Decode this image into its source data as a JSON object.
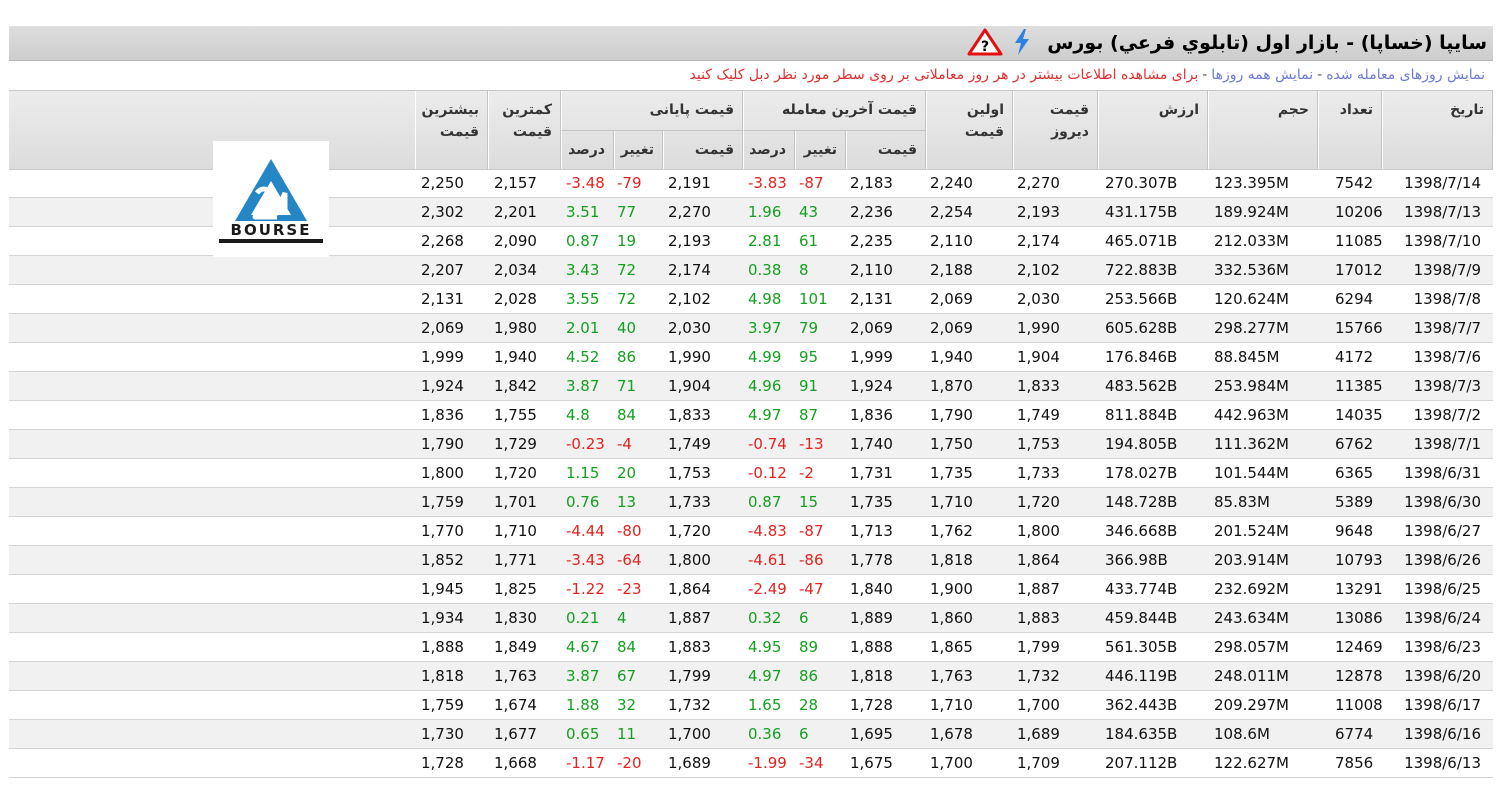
{
  "title": "سایپا (خساپا) - بازار اول (تابلوي فرعي) بورس",
  "icons": {
    "bolt": "lightning-bolt-icon",
    "warning": "warning-triangle-question-icon"
  },
  "colors": {
    "positive": "#13a01e",
    "negative": "#e4231f",
    "link": "#6d7bd8",
    "hint": "#e03030"
  },
  "info": {
    "link_traded": "نمایش روزهای معامله شده",
    "separator": "-",
    "link_all": "نمایش همه روزها",
    "hint": "برای مشاهده اطلاعات بیشتر در هر روز معاملاتی بر روی سطر مورد نظر دبل کلیک کنید"
  },
  "headers": {
    "date": "تاریخ",
    "count": "تعداد",
    "volume": "حجم",
    "value": "ارزش",
    "yesterday": "قیمت دیروز",
    "first": "اولین قیمت",
    "last_group": "قیمت آخرین معامله",
    "close_group": "قیمت پایانی",
    "price": "قیمت",
    "change": "تغییر",
    "percent": "درصد",
    "min": "کمترین قیمت",
    "max": "بیشترین قیمت"
  },
  "rows": [
    {
      "date": "1398/7/14",
      "count": "7542",
      "volume": "123.395M",
      "value": "270.307B",
      "yesterday": "2,270",
      "first": "2,240",
      "last_price": "2,183",
      "last_change": "-87",
      "last_pct": "-3.83",
      "close_price": "2,191",
      "close_change": "-79",
      "close_pct": "-3.48",
      "min": "2,157",
      "max": "2,250"
    },
    {
      "date": "1398/7/13",
      "count": "10206",
      "volume": "189.924M",
      "value": "431.175B",
      "yesterday": "2,193",
      "first": "2,254",
      "last_price": "2,236",
      "last_change": "43",
      "last_pct": "1.96",
      "close_price": "2,270",
      "close_change": "77",
      "close_pct": "3.51",
      "min": "2,201",
      "max": "2,302"
    },
    {
      "date": "1398/7/10",
      "count": "11085",
      "volume": "212.033M",
      "value": "465.071B",
      "yesterday": "2,174",
      "first": "2,110",
      "last_price": "2,235",
      "last_change": "61",
      "last_pct": "2.81",
      "close_price": "2,193",
      "close_change": "19",
      "close_pct": "0.87",
      "min": "2,090",
      "max": "2,268"
    },
    {
      "date": "1398/7/9",
      "count": "17012",
      "volume": "332.536M",
      "value": "722.883B",
      "yesterday": "2,102",
      "first": "2,188",
      "last_price": "2,110",
      "last_change": "8",
      "last_pct": "0.38",
      "close_price": "2,174",
      "close_change": "72",
      "close_pct": "3.43",
      "min": "2,034",
      "max": "2,207"
    },
    {
      "date": "1398/7/8",
      "count": "6294",
      "volume": "120.624M",
      "value": "253.566B",
      "yesterday": "2,030",
      "first": "2,069",
      "last_price": "2,131",
      "last_change": "101",
      "last_pct": "4.98",
      "close_price": "2,102",
      "close_change": "72",
      "close_pct": "3.55",
      "min": "2,028",
      "max": "2,131"
    },
    {
      "date": "1398/7/7",
      "count": "15766",
      "volume": "298.277M",
      "value": "605.628B",
      "yesterday": "1,990",
      "first": "2,069",
      "last_price": "2,069",
      "last_change": "79",
      "last_pct": "3.97",
      "close_price": "2,030",
      "close_change": "40",
      "close_pct": "2.01",
      "min": "1,980",
      "max": "2,069"
    },
    {
      "date": "1398/7/6",
      "count": "4172",
      "volume": "88.845M",
      "value": "176.846B",
      "yesterday": "1,904",
      "first": "1,940",
      "last_price": "1,999",
      "last_change": "95",
      "last_pct": "4.99",
      "close_price": "1,990",
      "close_change": "86",
      "close_pct": "4.52",
      "min": "1,940",
      "max": "1,999"
    },
    {
      "date": "1398/7/3",
      "count": "11385",
      "volume": "253.984M",
      "value": "483.562B",
      "yesterday": "1,833",
      "first": "1,870",
      "last_price": "1,924",
      "last_change": "91",
      "last_pct": "4.96",
      "close_price": "1,904",
      "close_change": "71",
      "close_pct": "3.87",
      "min": "1,842",
      "max": "1,924"
    },
    {
      "date": "1398/7/2",
      "count": "14035",
      "volume": "442.963M",
      "value": "811.884B",
      "yesterday": "1,749",
      "first": "1,790",
      "last_price": "1,836",
      "last_change": "87",
      "last_pct": "4.97",
      "close_price": "1,833",
      "close_change": "84",
      "close_pct": "4.8",
      "min": "1,755",
      "max": "1,836"
    },
    {
      "date": "1398/7/1",
      "count": "6762",
      "volume": "111.362M",
      "value": "194.805B",
      "yesterday": "1,753",
      "first": "1,750",
      "last_price": "1,740",
      "last_change": "-13",
      "last_pct": "-0.74",
      "close_price": "1,749",
      "close_change": "-4",
      "close_pct": "-0.23",
      "min": "1,729",
      "max": "1,790"
    },
    {
      "date": "1398/6/31",
      "count": "6365",
      "volume": "101.544M",
      "value": "178.027B",
      "yesterday": "1,733",
      "first": "1,735",
      "last_price": "1,731",
      "last_change": "-2",
      "last_pct": "-0.12",
      "close_price": "1,753",
      "close_change": "20",
      "close_pct": "1.15",
      "min": "1,720",
      "max": "1,800"
    },
    {
      "date": "1398/6/30",
      "count": "5389",
      "volume": "85.83M",
      "value": "148.728B",
      "yesterday": "1,720",
      "first": "1,710",
      "last_price": "1,735",
      "last_change": "15",
      "last_pct": "0.87",
      "close_price": "1,733",
      "close_change": "13",
      "close_pct": "0.76",
      "min": "1,701",
      "max": "1,759"
    },
    {
      "date": "1398/6/27",
      "count": "9648",
      "volume": "201.524M",
      "value": "346.668B",
      "yesterday": "1,800",
      "first": "1,762",
      "last_price": "1,713",
      "last_change": "-87",
      "last_pct": "-4.83",
      "close_price": "1,720",
      "close_change": "-80",
      "close_pct": "-4.44",
      "min": "1,710",
      "max": "1,770"
    },
    {
      "date": "1398/6/26",
      "count": "10793",
      "volume": "203.914M",
      "value": "366.98B",
      "yesterday": "1,864",
      "first": "1,818",
      "last_price": "1,778",
      "last_change": "-86",
      "last_pct": "-4.61",
      "close_price": "1,800",
      "close_change": "-64",
      "close_pct": "-3.43",
      "min": "1,771",
      "max": "1,852"
    },
    {
      "date": "1398/6/25",
      "count": "13291",
      "volume": "232.692M",
      "value": "433.774B",
      "yesterday": "1,887",
      "first": "1,900",
      "last_price": "1,840",
      "last_change": "-47",
      "last_pct": "-2.49",
      "close_price": "1,864",
      "close_change": "-23",
      "close_pct": "-1.22",
      "min": "1,825",
      "max": "1,945"
    },
    {
      "date": "1398/6/24",
      "count": "13086",
      "volume": "243.634M",
      "value": "459.844B",
      "yesterday": "1,883",
      "first": "1,860",
      "last_price": "1,889",
      "last_change": "6",
      "last_pct": "0.32",
      "close_price": "1,887",
      "close_change": "4",
      "close_pct": "0.21",
      "min": "1,830",
      "max": "1,934"
    },
    {
      "date": "1398/6/23",
      "count": "12469",
      "volume": "298.057M",
      "value": "561.305B",
      "yesterday": "1,799",
      "first": "1,865",
      "last_price": "1,888",
      "last_change": "89",
      "last_pct": "4.95",
      "close_price": "1,883",
      "close_change": "84",
      "close_pct": "4.67",
      "min": "1,849",
      "max": "1,888"
    },
    {
      "date": "1398/6/20",
      "count": "12878",
      "volume": "248.011M",
      "value": "446.119B",
      "yesterday": "1,732",
      "first": "1,763",
      "last_price": "1,818",
      "last_change": "86",
      "last_pct": "4.97",
      "close_price": "1,799",
      "close_change": "67",
      "close_pct": "3.87",
      "min": "1,763",
      "max": "1,818"
    },
    {
      "date": "1398/6/17",
      "count": "11008",
      "volume": "209.297M",
      "value": "362.443B",
      "yesterday": "1,700",
      "first": "1,710",
      "last_price": "1,728",
      "last_change": "28",
      "last_pct": "1.65",
      "close_price": "1,732",
      "close_change": "32",
      "close_pct": "1.88",
      "min": "1,674",
      "max": "1,759"
    },
    {
      "date": "1398/6/16",
      "count": "6774",
      "volume": "108.6M",
      "value": "184.635B",
      "yesterday": "1,689",
      "first": "1,678",
      "last_price": "1,695",
      "last_change": "6",
      "last_pct": "0.36",
      "close_price": "1,700",
      "close_change": "11",
      "close_pct": "0.65",
      "min": "1,677",
      "max": "1,730"
    },
    {
      "date": "1398/6/13",
      "count": "7856",
      "volume": "122.627M",
      "value": "207.112B",
      "yesterday": "1,709",
      "first": "1,700",
      "last_price": "1,675",
      "last_change": "-34",
      "last_pct": "-1.99",
      "close_price": "1,689",
      "close_change": "-20",
      "close_pct": "-1.17",
      "min": "1,668",
      "max": "1,728"
    }
  ]
}
